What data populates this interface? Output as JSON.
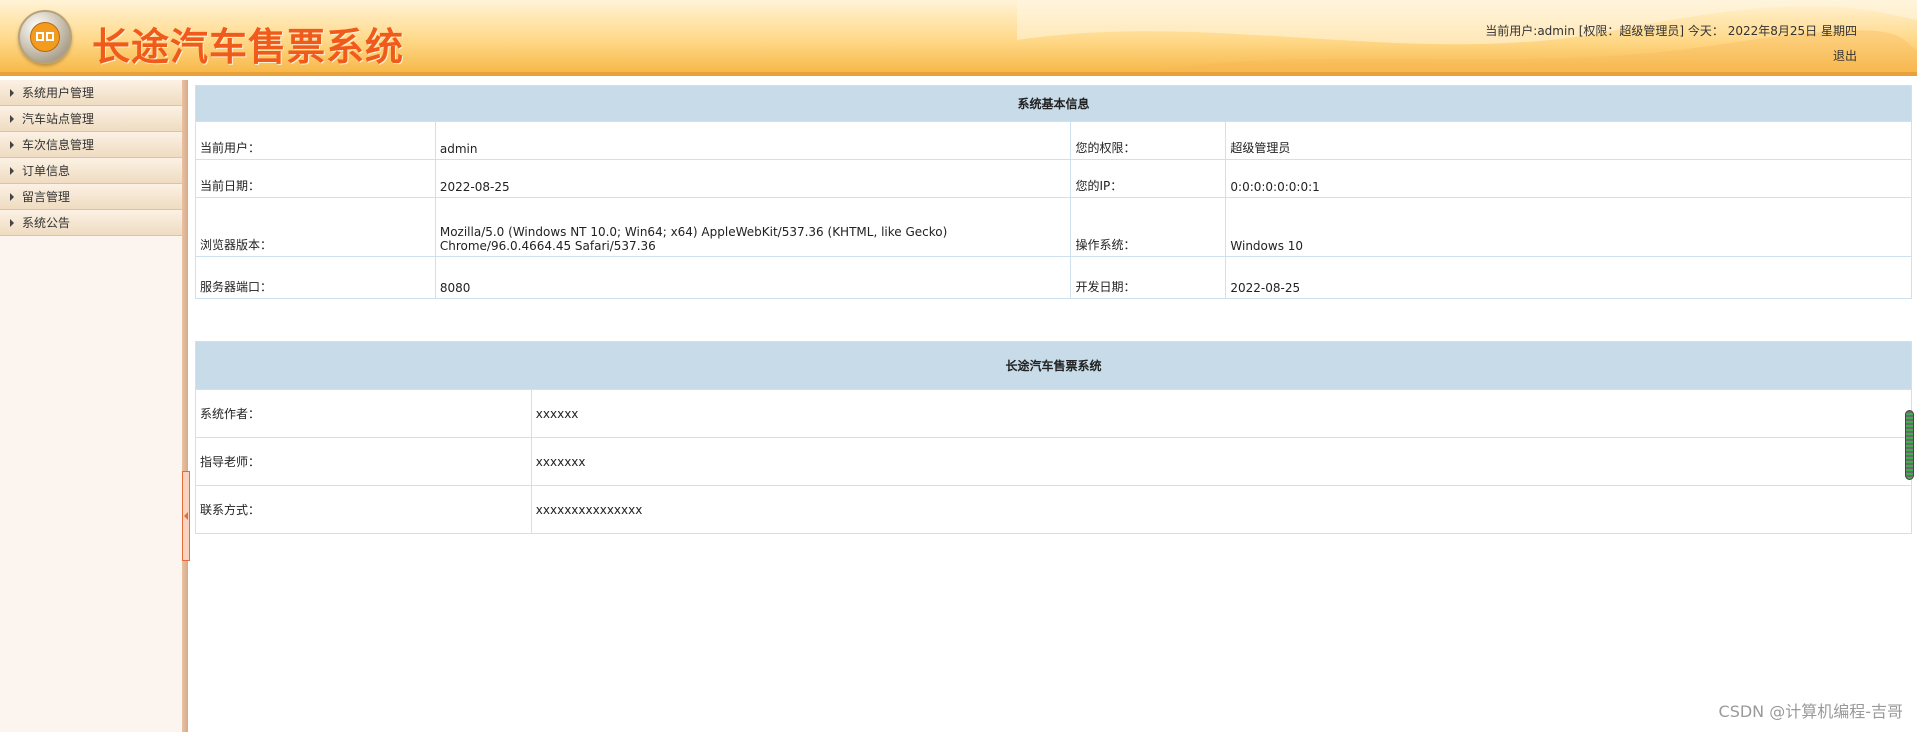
{
  "header": {
    "app_title": "长途汽车售票系统",
    "user_info": "当前用户:admin [权限：超级管理员] 今天：  2022年8月25日 星期四",
    "logout_label": "退出"
  },
  "sidebar": {
    "items": [
      {
        "label": "系统用户管理"
      },
      {
        "label": "汽车站点管理"
      },
      {
        "label": "车次信息管理"
      },
      {
        "label": "订单信息"
      },
      {
        "label": "留言管理"
      },
      {
        "label": "系统公告"
      }
    ]
  },
  "system_info": {
    "title": "系统基本信息",
    "current_user_label": "当前用户：",
    "current_user_value": "admin",
    "permission_label": "您的权限：",
    "permission_value": "超级管理员",
    "current_date_label": "当前日期：",
    "current_date_value": "2022-08-25",
    "ip_label": "您的IP：",
    "ip_value": "0:0:0:0:0:0:0:1",
    "browser_label": "浏览器版本：",
    "browser_value": "Mozilla/5.0 (Windows NT 10.0; Win64; x64) AppleWebKit/537.36 (KHTML, like Gecko) Chrome/96.0.4664.45 Safari/537.36",
    "os_label": "操作系统：",
    "os_value": "Windows 10",
    "port_label": "服务器端口：",
    "port_value": "8080",
    "dev_date_label": "开发日期：",
    "dev_date_value": "2022-08-25"
  },
  "about": {
    "title": "长途汽车售票系统",
    "author_label": "系统作者：",
    "author_value": "xxxxxx",
    "teacher_label": "指导老师：",
    "teacher_value": "xxxxxxx",
    "contact_label": "联系方式：",
    "contact_value": "xxxxxxxxxxxxxxx"
  },
  "watermark": "CSDN @计算机编程-吉哥",
  "colors": {
    "title": "#f05a1a",
    "header_bg": "#ffd98a",
    "section_header_bg": "#c8dbe9",
    "sidebar_bg": "#fcf4ee"
  }
}
